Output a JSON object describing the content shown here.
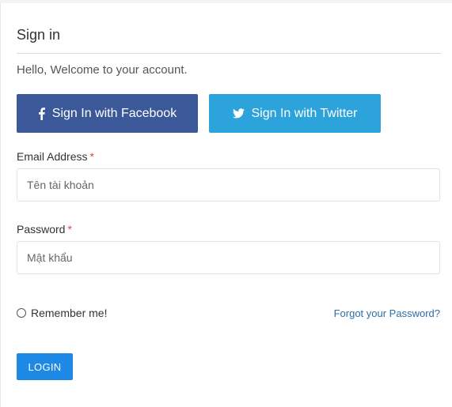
{
  "signin": {
    "title": "Sign in",
    "welcome": "Hello, Welcome to your account."
  },
  "social": {
    "facebook_label": "Sign In with Facebook",
    "facebook_icon": "facebook-icon",
    "facebook_color": "#3b5998",
    "twitter_label": "Sign In with Twitter",
    "twitter_icon": "twitter-icon",
    "twitter_color": "#2ca4db"
  },
  "form": {
    "email_label": "Email Address",
    "email_placeholder": "Tên tài khoản",
    "password_label": "Password",
    "password_placeholder": "Mật khẩu",
    "required_mark": "*",
    "remember_label": "Remember me!",
    "forgot_link": "Forgot your Password?",
    "login_label": "LOGIN",
    "login_color": "#1e88e5"
  }
}
